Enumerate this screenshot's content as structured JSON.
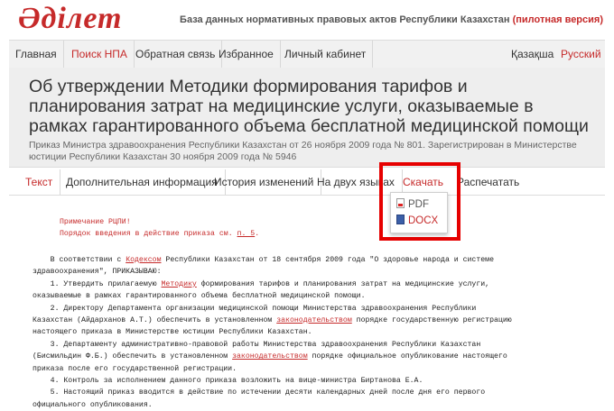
{
  "header": {
    "logo": "Әділет",
    "tagline": "База данных нормативных правовых актов Республики Казахстан",
    "tagline_pilot": "(пилотная версия)"
  },
  "nav": {
    "items": [
      "Главная",
      "Поиск НПА",
      "Обратная связь",
      "Избранное",
      "Личный кабинет"
    ],
    "active_index": 1,
    "lang": [
      "Қазақша",
      "Русский"
    ]
  },
  "doc": {
    "title": "Об утверждении Методики формирования тарифов и планирования затрат на медицинские услуги, оказываемые в рамках гарантированного объема бесплатной медицинской помощи",
    "subtitle": "Приказ Министра здравоохранения Республики Казахстан от 26 ноября 2009 года № 801. Зарегистрирован в Министерстве юстиции Республики Казахстан 30 ноября 2009 года № 5946"
  },
  "tabs": [
    "Текст",
    "Дополнительная информация",
    "История изменений",
    "На двух языках",
    "Скачать",
    "Распечатать"
  ],
  "download_menu": {
    "pdf": "PDF",
    "docx": "DOCX"
  },
  "body": {
    "note1": "Примечание РЦПИ!",
    "note2_pre": "Порядок введения в действие приказа см. ",
    "note2_link": "п. 5",
    "note2_post": ".",
    "lines": [
      [
        "    В соответствии с ",
        "Кодексом",
        " Республики Казахстан от 18 сентября 2009 года \"О здоровье народа и системе"
      ],
      [
        "здравоохранения\", ПРИКАЗЫВАЮ:",
        "",
        ""
      ],
      [
        "    1. Утвердить прилагаемую ",
        "Методику",
        " формирования тарифов и планирования затрат на медицинские услуги,"
      ],
      [
        "оказываемые в рамках гарантированного объема бесплатной медицинской помощи.",
        "",
        ""
      ],
      [
        "    2. Директору Департамента организации медицинской помощи Министерства здравоохранения Республики",
        "",
        ""
      ],
      [
        "Казахстан (Айдарханов А.Т.) обеспечить в установленном ",
        "законодательством",
        " порядке государственную регистрацию"
      ],
      [
        "настоящего приказа в Министерстве юстиции Республики Казахстан.",
        "",
        ""
      ],
      [
        "    3. Департаменту административно-правовой работы Министерства здравоохранения Республики Казахстан",
        "",
        ""
      ],
      [
        "(Бисмильдин Ф.Б.) обеспечить в установленном ",
        "законодательством",
        " порядке официальное опубликование настоящего"
      ],
      [
        "приказа после его государственной регистрации.",
        "",
        ""
      ],
      [
        "    4. Контроль за исполнением данного приказа возложить на вице-министра Биртанова Е.А.",
        "",
        ""
      ],
      [
        "    5. Настоящий приказ вводится в действие по истечении десяти календарных дней после дня его первого",
        "",
        ""
      ],
      [
        "официального опубликования.",
        "",
        ""
      ]
    ]
  }
}
